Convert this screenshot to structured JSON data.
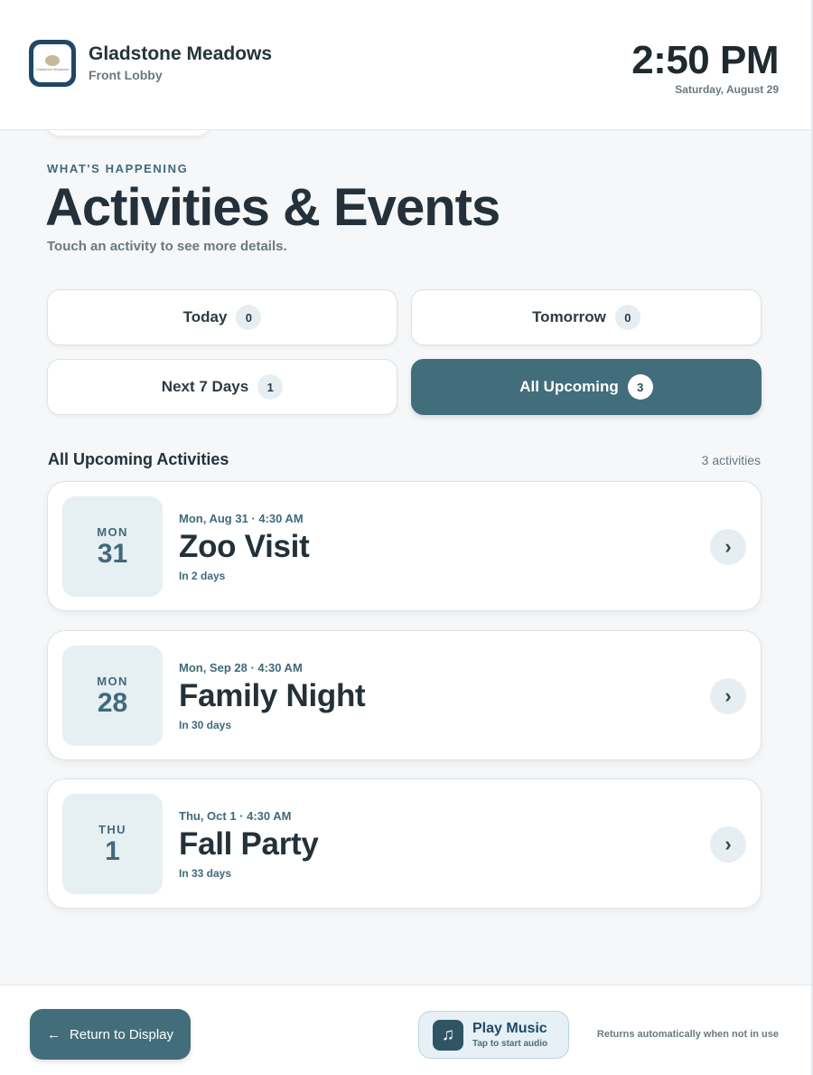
{
  "header": {
    "facility_name": "Gladstone Meadows",
    "location": "Front Lobby",
    "time": "2:50 PM",
    "date": "Saturday, August 29",
    "logo_text": "Gladstone Meadows"
  },
  "intro": {
    "eyebrow": "WHAT'S HAPPENING",
    "title": "Activities & Events",
    "subtitle": "Touch an activity to see more details."
  },
  "filters": [
    {
      "label": "Today",
      "count": "0",
      "active": false
    },
    {
      "label": "Tomorrow",
      "count": "0",
      "active": false
    },
    {
      "label": "Next 7 Days",
      "count": "1",
      "active": false
    },
    {
      "label": "All Upcoming",
      "count": "3",
      "active": true
    }
  ],
  "list": {
    "title": "All Upcoming Activities",
    "count_label": "3 activities"
  },
  "events": [
    {
      "dow": "MON",
      "day": "31",
      "when": "Mon, Aug 31 · 4:30 AM",
      "name": "Zoo Visit",
      "relative": "In 2 days"
    },
    {
      "dow": "MON",
      "day": "28",
      "when": "Mon, Sep 28 · 4:30 AM",
      "name": "Family Night",
      "relative": "In 30 days"
    },
    {
      "dow": "THU",
      "day": "1",
      "when": "Thu, Oct 1 · 4:30 AM",
      "name": "Fall Party",
      "relative": "In 33 days"
    }
  ],
  "footer": {
    "return_label": "Return to Display",
    "music_title": "Play Music",
    "music_sub": "Tap to start audio",
    "auto_note": "Returns automatically when not in use"
  },
  "icons": {
    "back": "arrow-left-icon",
    "music": "music-note-icon",
    "chevron": "chevron-right-icon"
  },
  "colors": {
    "accent": "#426d7b",
    "logo_frame": "#1f4868",
    "tile_bg": "#e6eff2"
  }
}
